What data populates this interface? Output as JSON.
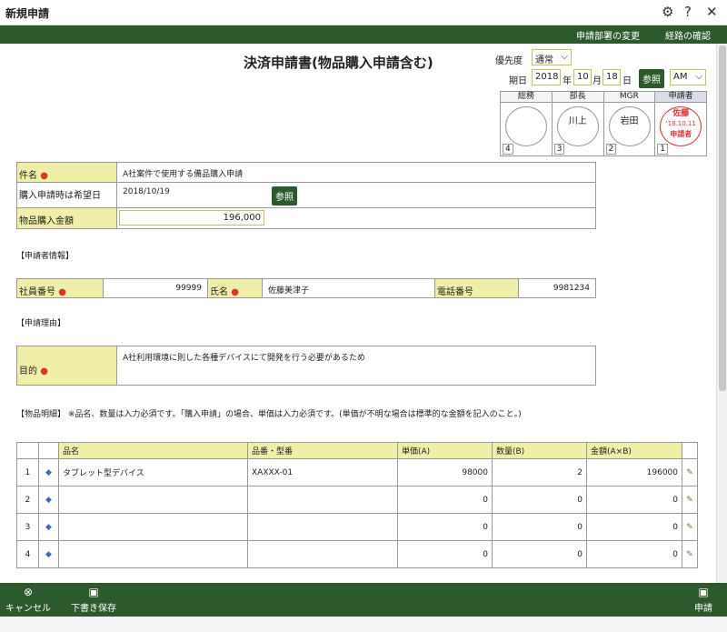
{
  "window": {
    "title": "新規申請",
    "settings_icon": "⚙",
    "help_icon": "?",
    "close_icon": "✕"
  },
  "links": {
    "change_dept": "申請部署の変更",
    "route_confirm": "経路の確認"
  },
  "doc": {
    "title": "決済申請書(物品購入申請含む)"
  },
  "priority": {
    "label": "優先度",
    "value": "通常"
  },
  "deadline": {
    "label": "期日",
    "year": "2018",
    "year_unit": "年",
    "month": "10",
    "month_unit": "月",
    "day": "18",
    "day_unit": "日",
    "ref_button": "参照",
    "ampm": "AM"
  },
  "approval": {
    "columns": [
      {
        "header": "総務",
        "stamp": "",
        "num": "4"
      },
      {
        "header": "部長",
        "stamp": "川上",
        "num": "3"
      },
      {
        "header": "MGR",
        "stamp": "岩田",
        "num": "2"
      },
      {
        "header": "申請者",
        "stamp": "佐藤",
        "stamp_date": "'18.10.11",
        "stamp_role": "申請者",
        "num": "1"
      }
    ]
  },
  "form": {
    "subject_label": "件名",
    "subject_value": "A社案件で使用する備品購入申請",
    "date_label": "購入申請時は希望日",
    "date_value": "2018/10/19",
    "date_ref": "参照",
    "amount_label": "物品購入金額",
    "amount_value": "196,000"
  },
  "applicant": {
    "section": "【申請者情報】",
    "emp_no_label": "社員番号",
    "emp_no_value": "99999",
    "name_label": "氏名",
    "name_value": "佐藤美津子",
    "phone_label": "電話番号",
    "phone_value": "9981234"
  },
  "reason": {
    "section": "【申請理由】",
    "purpose_label": "目的",
    "purpose_value": "A社利用環境に則した各種デバイスにて開発を行う必要があるため"
  },
  "items": {
    "section": "【物品明細】 ※品名、数量は入力必須です。「購入申請」の場合、単価は入力必須です。(単価が不明な場合は標準的な金額を記入のこと。)",
    "headers": {
      "name": "品名",
      "model": "品番・型番",
      "price": "単価(A)",
      "qty": "数量(B)",
      "total": "金額(A×B)"
    },
    "rows": [
      {
        "no": "1",
        "name": "タブレット型デバイス",
        "model": "XAXXX-01",
        "price": "98000",
        "qty": "2",
        "total": "196000"
      },
      {
        "no": "2",
        "name": "",
        "model": "",
        "price": "0",
        "qty": "0",
        "total": "0"
      },
      {
        "no": "3",
        "name": "",
        "model": "",
        "price": "0",
        "qty": "0",
        "total": "0"
      },
      {
        "no": "4",
        "name": "",
        "model": "",
        "price": "0",
        "qty": "0",
        "total": "0"
      }
    ]
  },
  "bottom": {
    "cancel": "キャンセル",
    "draft": "下書き保存",
    "submit": "申請"
  }
}
